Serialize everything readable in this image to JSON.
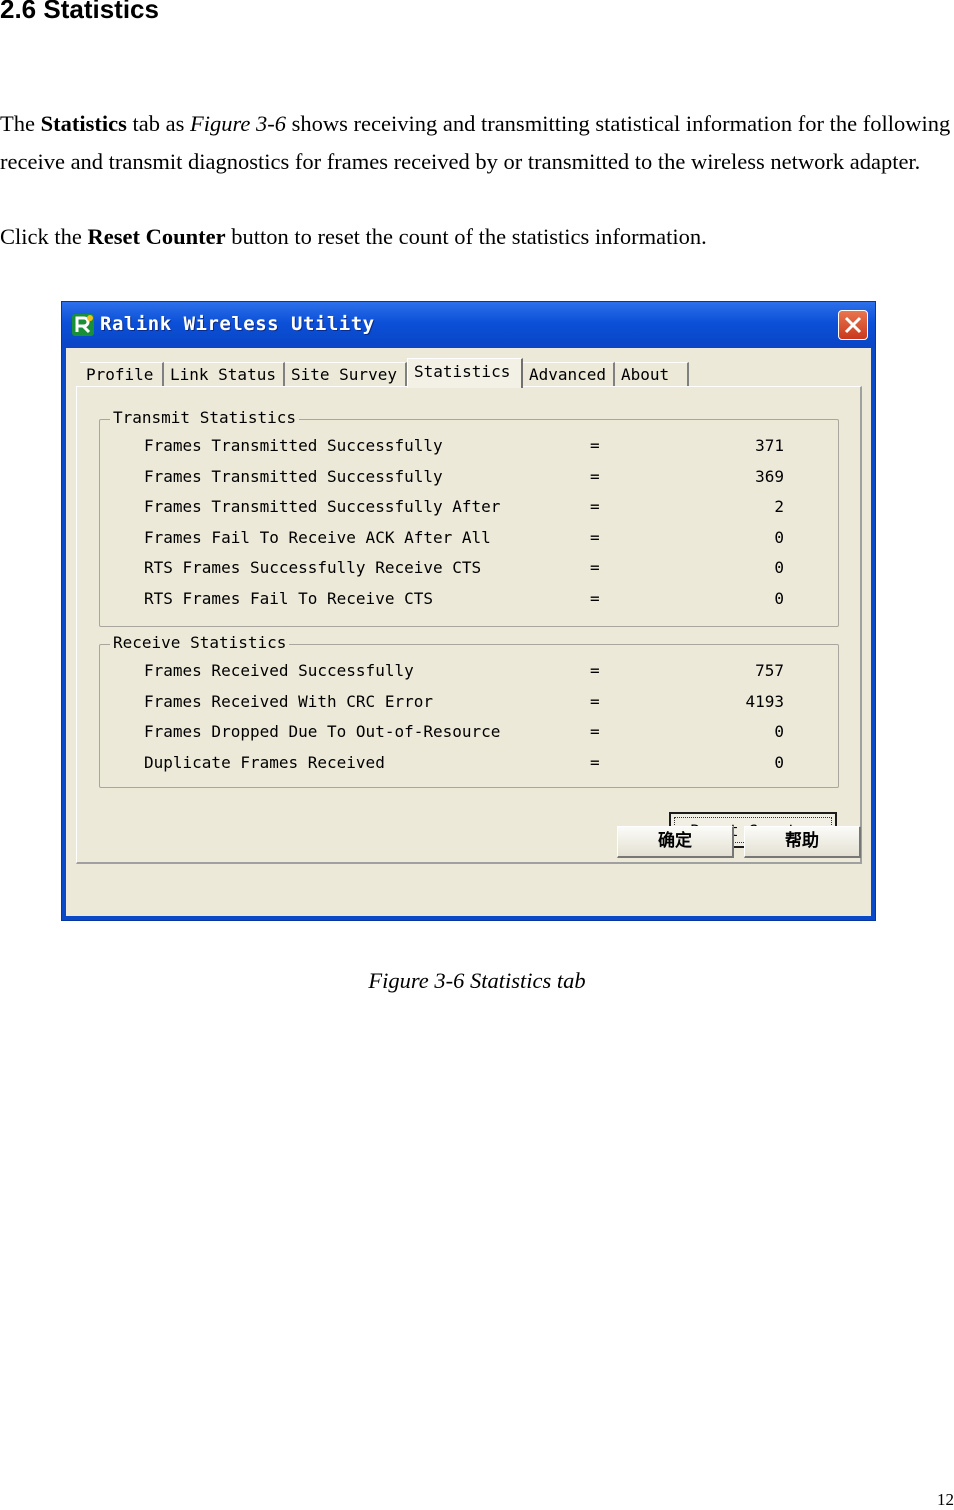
{
  "heading": "2.6 Statistics",
  "intro": {
    "p1_a": "The ",
    "p1_b": "Statistics",
    "p1_c": " tab as ",
    "p1_d": "Figure 3-6",
    "p1_e": " shows receiving and transmitting statistical information for the following receive and transmit diagnostics for frames received by or transmitted to the wireless network adapter.",
    "p2_a": "Click the ",
    "p2_b": "Reset Counter",
    "p2_c": " button to reset the count of the statistics information."
  },
  "window": {
    "title": "Ralink Wireless Utility",
    "tabs": [
      "Profile",
      "Link Status",
      "Site Survey",
      "Statistics",
      "Advanced",
      "About"
    ],
    "active_tab": "Statistics",
    "transmit": {
      "label": "Transmit Statistics",
      "rows": [
        {
          "label": "Frames Transmitted Successfully",
          "value": "371"
        },
        {
          "label": "Frames Transmitted Successfully",
          "value": "369"
        },
        {
          "label": "Frames Transmitted Successfully After",
          "value": "2"
        },
        {
          "label": "Frames Fail To Receive ACK After All",
          "value": "0"
        },
        {
          "label": "RTS Frames Successfully Receive CTS",
          "value": "0"
        },
        {
          "label": "RTS Frames Fail To Receive CTS",
          "value": "0"
        }
      ]
    },
    "receive": {
      "label": "Receive Statistics",
      "rows": [
        {
          "label": "Frames Received Successfully",
          "value": "757"
        },
        {
          "label": "Frames Received With CRC Error",
          "value": "4193"
        },
        {
          "label": "Frames Dropped Due To Out-of-Resource",
          "value": "0"
        },
        {
          "label": "Duplicate Frames Received",
          "value": "0"
        }
      ]
    },
    "equals": "=",
    "reset_button": "Reset Counter",
    "ok_button": "确定",
    "help_button": "帮助"
  },
  "caption": "Figure 3-6 Statistics tab",
  "page_number": "12",
  "colors": {
    "titlebar": "#0b50d8",
    "client": "#ece9d8",
    "close": "#c9381d"
  }
}
